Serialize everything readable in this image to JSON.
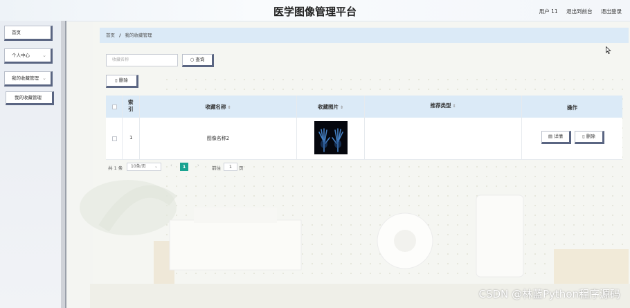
{
  "header": {
    "title": "医学图像管理平台",
    "user_label": "用户 11",
    "back_label": "退出到前台",
    "logout_label": "退出登录"
  },
  "sidebar": {
    "items": [
      {
        "label": "首页",
        "has_chevron": false
      },
      {
        "label": "个人中心",
        "has_chevron": true
      },
      {
        "label": "我的收藏管理",
        "has_chevron": true
      }
    ],
    "sub_item": "我的收藏管理"
  },
  "breadcrumb": {
    "home": "首页",
    "separator": "/",
    "current": "我的收藏管理"
  },
  "search": {
    "placeholder": "收藏名称",
    "button_label": "查询"
  },
  "toolbar": {
    "delete_label": "删除"
  },
  "table": {
    "columns": [
      "索引",
      "收藏名称",
      "收藏图片",
      "推荐类型",
      "操作"
    ],
    "rows": [
      {
        "index": "1",
        "name": "图像名称2",
        "type": "",
        "detail_label": "详情",
        "delete_label": "删除"
      }
    ]
  },
  "pager": {
    "total": "共 1 条",
    "page_size": "10条/页",
    "current_page": "1",
    "goto_label": "前往",
    "goto_value": "1",
    "page_unit": "页"
  },
  "watermark": "CSDN @林蓝Python程序源码",
  "colors": {
    "accent": "#1aa391",
    "header_row": "#dbeaf7",
    "button_shadow": "#5a6582"
  }
}
